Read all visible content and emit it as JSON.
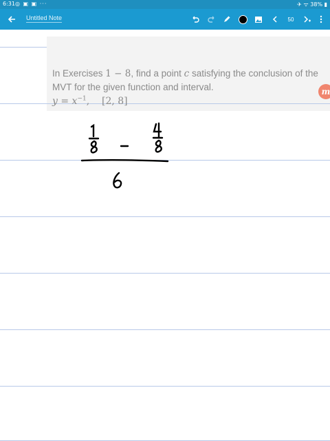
{
  "status_bar": {
    "time": "6:31",
    "notification_icons": "◎ ▣ ▣ ···",
    "battery_text": "38%",
    "right_icons": "✈ ᯤ"
  },
  "toolbar": {
    "note_title": "Untitled Note",
    "page_number": "50",
    "icons": [
      "back-arrow-icon",
      "undo-icon",
      "redo-icon",
      "pen-icon",
      "color-dot-icon",
      "image-icon",
      "prev-page-icon",
      "next-page-icon",
      "more-icon"
    ]
  },
  "question": {
    "line1_prefix": "In Exercises ",
    "range_expr": "1 − 8",
    "line1_mid": ", find a point ",
    "var_c": "c",
    "line1_suffix": " satisfying the conclusion of the",
    "line2": "MVT for the given function and interval.",
    "function_lhs": "y = x",
    "function_exp": "−1",
    "interval": "[2, 8]",
    "badge": "m"
  },
  "handwriting": {
    "left_top": "1",
    "left_bottom": "8",
    "minus": "-",
    "right_top": "4",
    "right_bottom": "8",
    "denominator": "6"
  },
  "colors": {
    "toolbar": "#1b9ad1",
    "status": "#1f8fbf",
    "rule_line": "#b8c9e8",
    "ink": "#000000"
  }
}
